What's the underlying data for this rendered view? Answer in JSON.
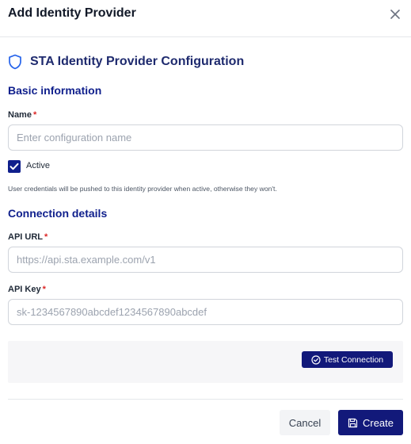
{
  "dialog": {
    "title": "Add Identity Provider",
    "close_icon": "close-icon"
  },
  "section": {
    "icon": "shield-icon",
    "title": "STA Identity Provider Configuration"
  },
  "basic": {
    "heading": "Basic information",
    "name_label": "Name",
    "required_mark": "*",
    "name_placeholder": "Enter configuration name",
    "name_value": "",
    "active_label": "Active",
    "active_checked": true,
    "help_text": "User credentials will be pushed to this identity provider when active, otherwise they won't."
  },
  "connection": {
    "heading": "Connection details",
    "api_url_label": "API URL",
    "api_url_placeholder": "https://api.sta.example.com/v1",
    "api_key_label": "API Key",
    "api_key_placeholder": "sk-1234567890abcdef1234567890abcdef",
    "test_button": "Test Connection",
    "test_icon": "check-circle-icon"
  },
  "footer": {
    "cancel_label": "Cancel",
    "create_label": "Create",
    "create_icon": "save-icon"
  },
  "colors": {
    "primary": "#12197a",
    "heading": "#0f1f8c",
    "required": "#dc2626"
  }
}
